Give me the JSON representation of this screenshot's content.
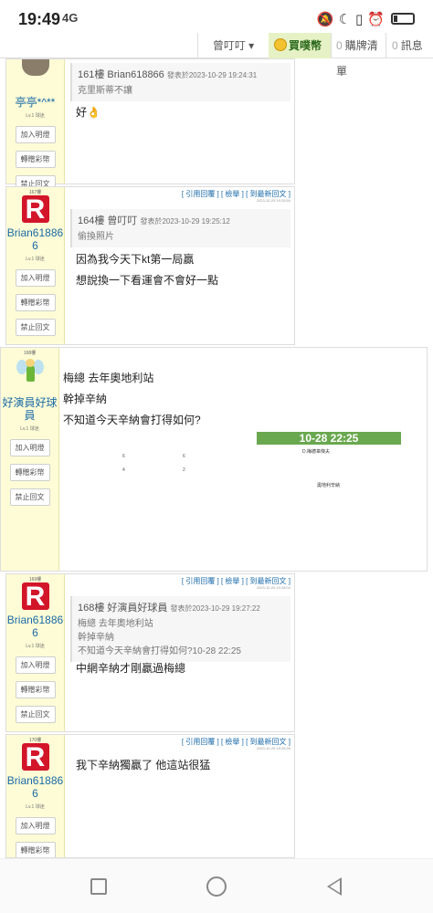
{
  "status": {
    "time": "19:49",
    "network": "4G",
    "icons": [
      "mute-icon",
      "moon-icon",
      "vibrate-icon",
      "alarm-icon",
      "battery-icon"
    ]
  },
  "top_nav": {
    "user": "曾叮叮 ▾",
    "coin_label": "買噗幣",
    "shop": {
      "count": "0",
      "label": "購牌清單"
    },
    "messages": {
      "count": "0",
      "label": "訊息"
    }
  },
  "side_buttons": {
    "add_friend": "加入明燈",
    "gift": "轉贈彩幣",
    "ban": "禁止回文"
  },
  "post_links": "[ 引用回覆 ] [ 檢舉 ] [ 到最新回文 ]",
  "posts": [
    {
      "username": "亭亭*^**",
      "level": "Lv.1 球迷",
      "quote_head": "161樓 Brian618866",
      "quote_time": "發表於2023-10-29 19:24:31",
      "quote_body": "克里斯蒂不讓",
      "content": [
        "好👌"
      ]
    },
    {
      "floor": "167樓",
      "date": "2023-10-29 19:25:50",
      "username": "Brian618866",
      "level": "Lv.1 球迷",
      "quote_head": "164樓 曾叮叮",
      "quote_time": "發表於2023-10-29 19:25:12",
      "quote_body": "偷換照片",
      "content": [
        "因為我今天下kt第一局贏",
        "想說換一下看運會不會好一點"
      ]
    },
    {
      "floor": "168樓",
      "username": "好演員好球員",
      "level": "Lv.1 球迷",
      "content": [
        "梅總 去年奧地利站",
        "幹掉辛納",
        "不知道今天辛納會打得如何?"
      ],
      "image": {
        "score_title": "10-28 22:25",
        "subtitle": "D.梅德韋傑夫",
        "footer": "奧地利辛納",
        "left_nums": [
          "6",
          "6",
          "4",
          "2"
        ]
      }
    },
    {
      "floor": "169樓",
      "date": "2023-10-29 19:28:04",
      "username": "Brian618866",
      "level": "Lv.1 球迷",
      "quote_head": "168樓 好演員好球員",
      "quote_time": "發表於2023-10-29 19:27:22",
      "quote_body": [
        "梅總 去年奧地利站",
        "幹掉辛納",
        "不知道今天辛納會打得如何?10-28 22:25"
      ],
      "content": [
        "中網辛納才剛贏過梅總"
      ]
    },
    {
      "floor": "170樓",
      "date": "2023-10-29 19:28:30",
      "username": "Brian618866",
      "level": "Lv.1 球迷",
      "content": [
        "我下辛納獨贏了 他這站很猛"
      ]
    }
  ]
}
